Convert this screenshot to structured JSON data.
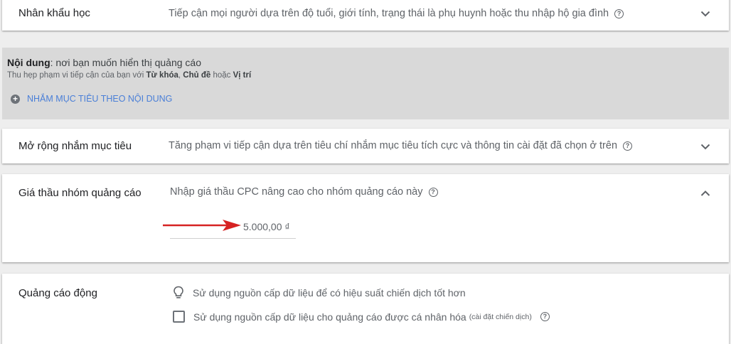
{
  "demographics": {
    "title": "Nhân khẩu học",
    "description": "Tiếp cận mọi người dựa trên độ tuổi, giới tính, trạng thái là phụ huynh hoặc thu nhập hộ gia đình",
    "help_icon": "?",
    "chevron_icon": "chevron-down-icon"
  },
  "content": {
    "title_bold": "Nội dung",
    "title_rest": ": nơi bạn muốn hiển thị quảng cáo",
    "sub_prefix": "Thu hẹp phạm vi tiếp cận của bạn với ",
    "sub_keywords": "Từ khóa",
    "sub_sep": ", ",
    "sub_topics": "Chủ đề",
    "sub_or": " hoặc ",
    "sub_placements": "Vị trí",
    "add_icon": "+",
    "link_label": "NHẮM MỤC TIÊU THEO NỘI DUNG"
  },
  "expansion": {
    "title": "Mở rộng nhắm mục tiêu",
    "description": "Tăng phạm vi tiếp cận dựa trên tiêu chí nhắm mục tiêu tích cực và thông tin cài đặt đã chọn ở trên",
    "help_icon": "?",
    "chevron_icon": "chevron-down-icon"
  },
  "bid": {
    "title": "Giá thầu nhóm quảng cáo",
    "description": "Nhập giá thầu CPC nâng cao cho nhóm quảng cáo này",
    "help_icon": "?",
    "value": "5.000,00 ₫",
    "chevron_icon": "chevron-up-icon",
    "arrow_color": "#d62222"
  },
  "dynamic_ads": {
    "title": "Quảng cáo động",
    "tip": "Sử dụng nguồn cấp dữ liệu để có hiệu suất chiến dịch tốt hơn",
    "checkbox_label": "Sử dụng nguồn cấp dữ liệu cho quảng cáo được cá nhân hóa",
    "checkbox_note": "(cài đặt chiến dịch)",
    "checkbox_checked": false,
    "help_icon": "?"
  },
  "colors": {
    "link": "#4a7fd8",
    "grey_section": "#d9d9d9"
  }
}
